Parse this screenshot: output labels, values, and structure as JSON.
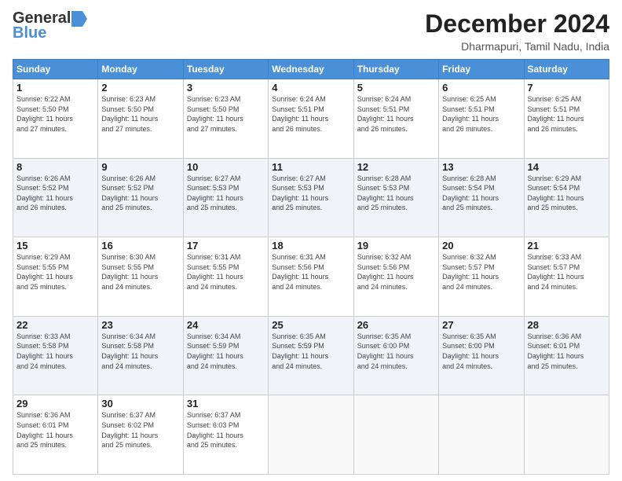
{
  "logo": {
    "general": "General",
    "blue": "Blue"
  },
  "title": "December 2024",
  "location": "Dharmapuri, Tamil Nadu, India",
  "days_of_week": [
    "Sunday",
    "Monday",
    "Tuesday",
    "Wednesday",
    "Thursday",
    "Friday",
    "Saturday"
  ],
  "weeks": [
    [
      {
        "day": "1",
        "info": "Sunrise: 6:22 AM\nSunset: 5:50 PM\nDaylight: 11 hours\nand 27 minutes."
      },
      {
        "day": "2",
        "info": "Sunrise: 6:23 AM\nSunset: 5:50 PM\nDaylight: 11 hours\nand 27 minutes."
      },
      {
        "day": "3",
        "info": "Sunrise: 6:23 AM\nSunset: 5:50 PM\nDaylight: 11 hours\nand 27 minutes."
      },
      {
        "day": "4",
        "info": "Sunrise: 6:24 AM\nSunset: 5:51 PM\nDaylight: 11 hours\nand 26 minutes."
      },
      {
        "day": "5",
        "info": "Sunrise: 6:24 AM\nSunset: 5:51 PM\nDaylight: 11 hours\nand 26 minutes."
      },
      {
        "day": "6",
        "info": "Sunrise: 6:25 AM\nSunset: 5:51 PM\nDaylight: 11 hours\nand 26 minutes."
      },
      {
        "day": "7",
        "info": "Sunrise: 6:25 AM\nSunset: 5:51 PM\nDaylight: 11 hours\nand 26 minutes."
      }
    ],
    [
      {
        "day": "8",
        "info": "Sunrise: 6:26 AM\nSunset: 5:52 PM\nDaylight: 11 hours\nand 26 minutes."
      },
      {
        "day": "9",
        "info": "Sunrise: 6:26 AM\nSunset: 5:52 PM\nDaylight: 11 hours\nand 25 minutes."
      },
      {
        "day": "10",
        "info": "Sunrise: 6:27 AM\nSunset: 5:53 PM\nDaylight: 11 hours\nand 25 minutes."
      },
      {
        "day": "11",
        "info": "Sunrise: 6:27 AM\nSunset: 5:53 PM\nDaylight: 11 hours\nand 25 minutes."
      },
      {
        "day": "12",
        "info": "Sunrise: 6:28 AM\nSunset: 5:53 PM\nDaylight: 11 hours\nand 25 minutes."
      },
      {
        "day": "13",
        "info": "Sunrise: 6:28 AM\nSunset: 5:54 PM\nDaylight: 11 hours\nand 25 minutes."
      },
      {
        "day": "14",
        "info": "Sunrise: 6:29 AM\nSunset: 5:54 PM\nDaylight: 11 hours\nand 25 minutes."
      }
    ],
    [
      {
        "day": "15",
        "info": "Sunrise: 6:29 AM\nSunset: 5:55 PM\nDaylight: 11 hours\nand 25 minutes."
      },
      {
        "day": "16",
        "info": "Sunrise: 6:30 AM\nSunset: 5:55 PM\nDaylight: 11 hours\nand 24 minutes."
      },
      {
        "day": "17",
        "info": "Sunrise: 6:31 AM\nSunset: 5:55 PM\nDaylight: 11 hours\nand 24 minutes."
      },
      {
        "day": "18",
        "info": "Sunrise: 6:31 AM\nSunset: 5:56 PM\nDaylight: 11 hours\nand 24 minutes."
      },
      {
        "day": "19",
        "info": "Sunrise: 6:32 AM\nSunset: 5:56 PM\nDaylight: 11 hours\nand 24 minutes."
      },
      {
        "day": "20",
        "info": "Sunrise: 6:32 AM\nSunset: 5:57 PM\nDaylight: 11 hours\nand 24 minutes."
      },
      {
        "day": "21",
        "info": "Sunrise: 6:33 AM\nSunset: 5:57 PM\nDaylight: 11 hours\nand 24 minutes."
      }
    ],
    [
      {
        "day": "22",
        "info": "Sunrise: 6:33 AM\nSunset: 5:58 PM\nDaylight: 11 hours\nand 24 minutes."
      },
      {
        "day": "23",
        "info": "Sunrise: 6:34 AM\nSunset: 5:58 PM\nDaylight: 11 hours\nand 24 minutes."
      },
      {
        "day": "24",
        "info": "Sunrise: 6:34 AM\nSunset: 5:59 PM\nDaylight: 11 hours\nand 24 minutes."
      },
      {
        "day": "25",
        "info": "Sunrise: 6:35 AM\nSunset: 5:59 PM\nDaylight: 11 hours\nand 24 minutes."
      },
      {
        "day": "26",
        "info": "Sunrise: 6:35 AM\nSunset: 6:00 PM\nDaylight: 11 hours\nand 24 minutes."
      },
      {
        "day": "27",
        "info": "Sunrise: 6:35 AM\nSunset: 6:00 PM\nDaylight: 11 hours\nand 24 minutes."
      },
      {
        "day": "28",
        "info": "Sunrise: 6:36 AM\nSunset: 6:01 PM\nDaylight: 11 hours\nand 25 minutes."
      }
    ],
    [
      {
        "day": "29",
        "info": "Sunrise: 6:36 AM\nSunset: 6:01 PM\nDaylight: 11 hours\nand 25 minutes."
      },
      {
        "day": "30",
        "info": "Sunrise: 6:37 AM\nSunset: 6:02 PM\nDaylight: 11 hours\nand 25 minutes."
      },
      {
        "day": "31",
        "info": "Sunrise: 6:37 AM\nSunset: 6:03 PM\nDaylight: 11 hours\nand 25 minutes."
      },
      {
        "day": "",
        "info": ""
      },
      {
        "day": "",
        "info": ""
      },
      {
        "day": "",
        "info": ""
      },
      {
        "day": "",
        "info": ""
      }
    ]
  ]
}
